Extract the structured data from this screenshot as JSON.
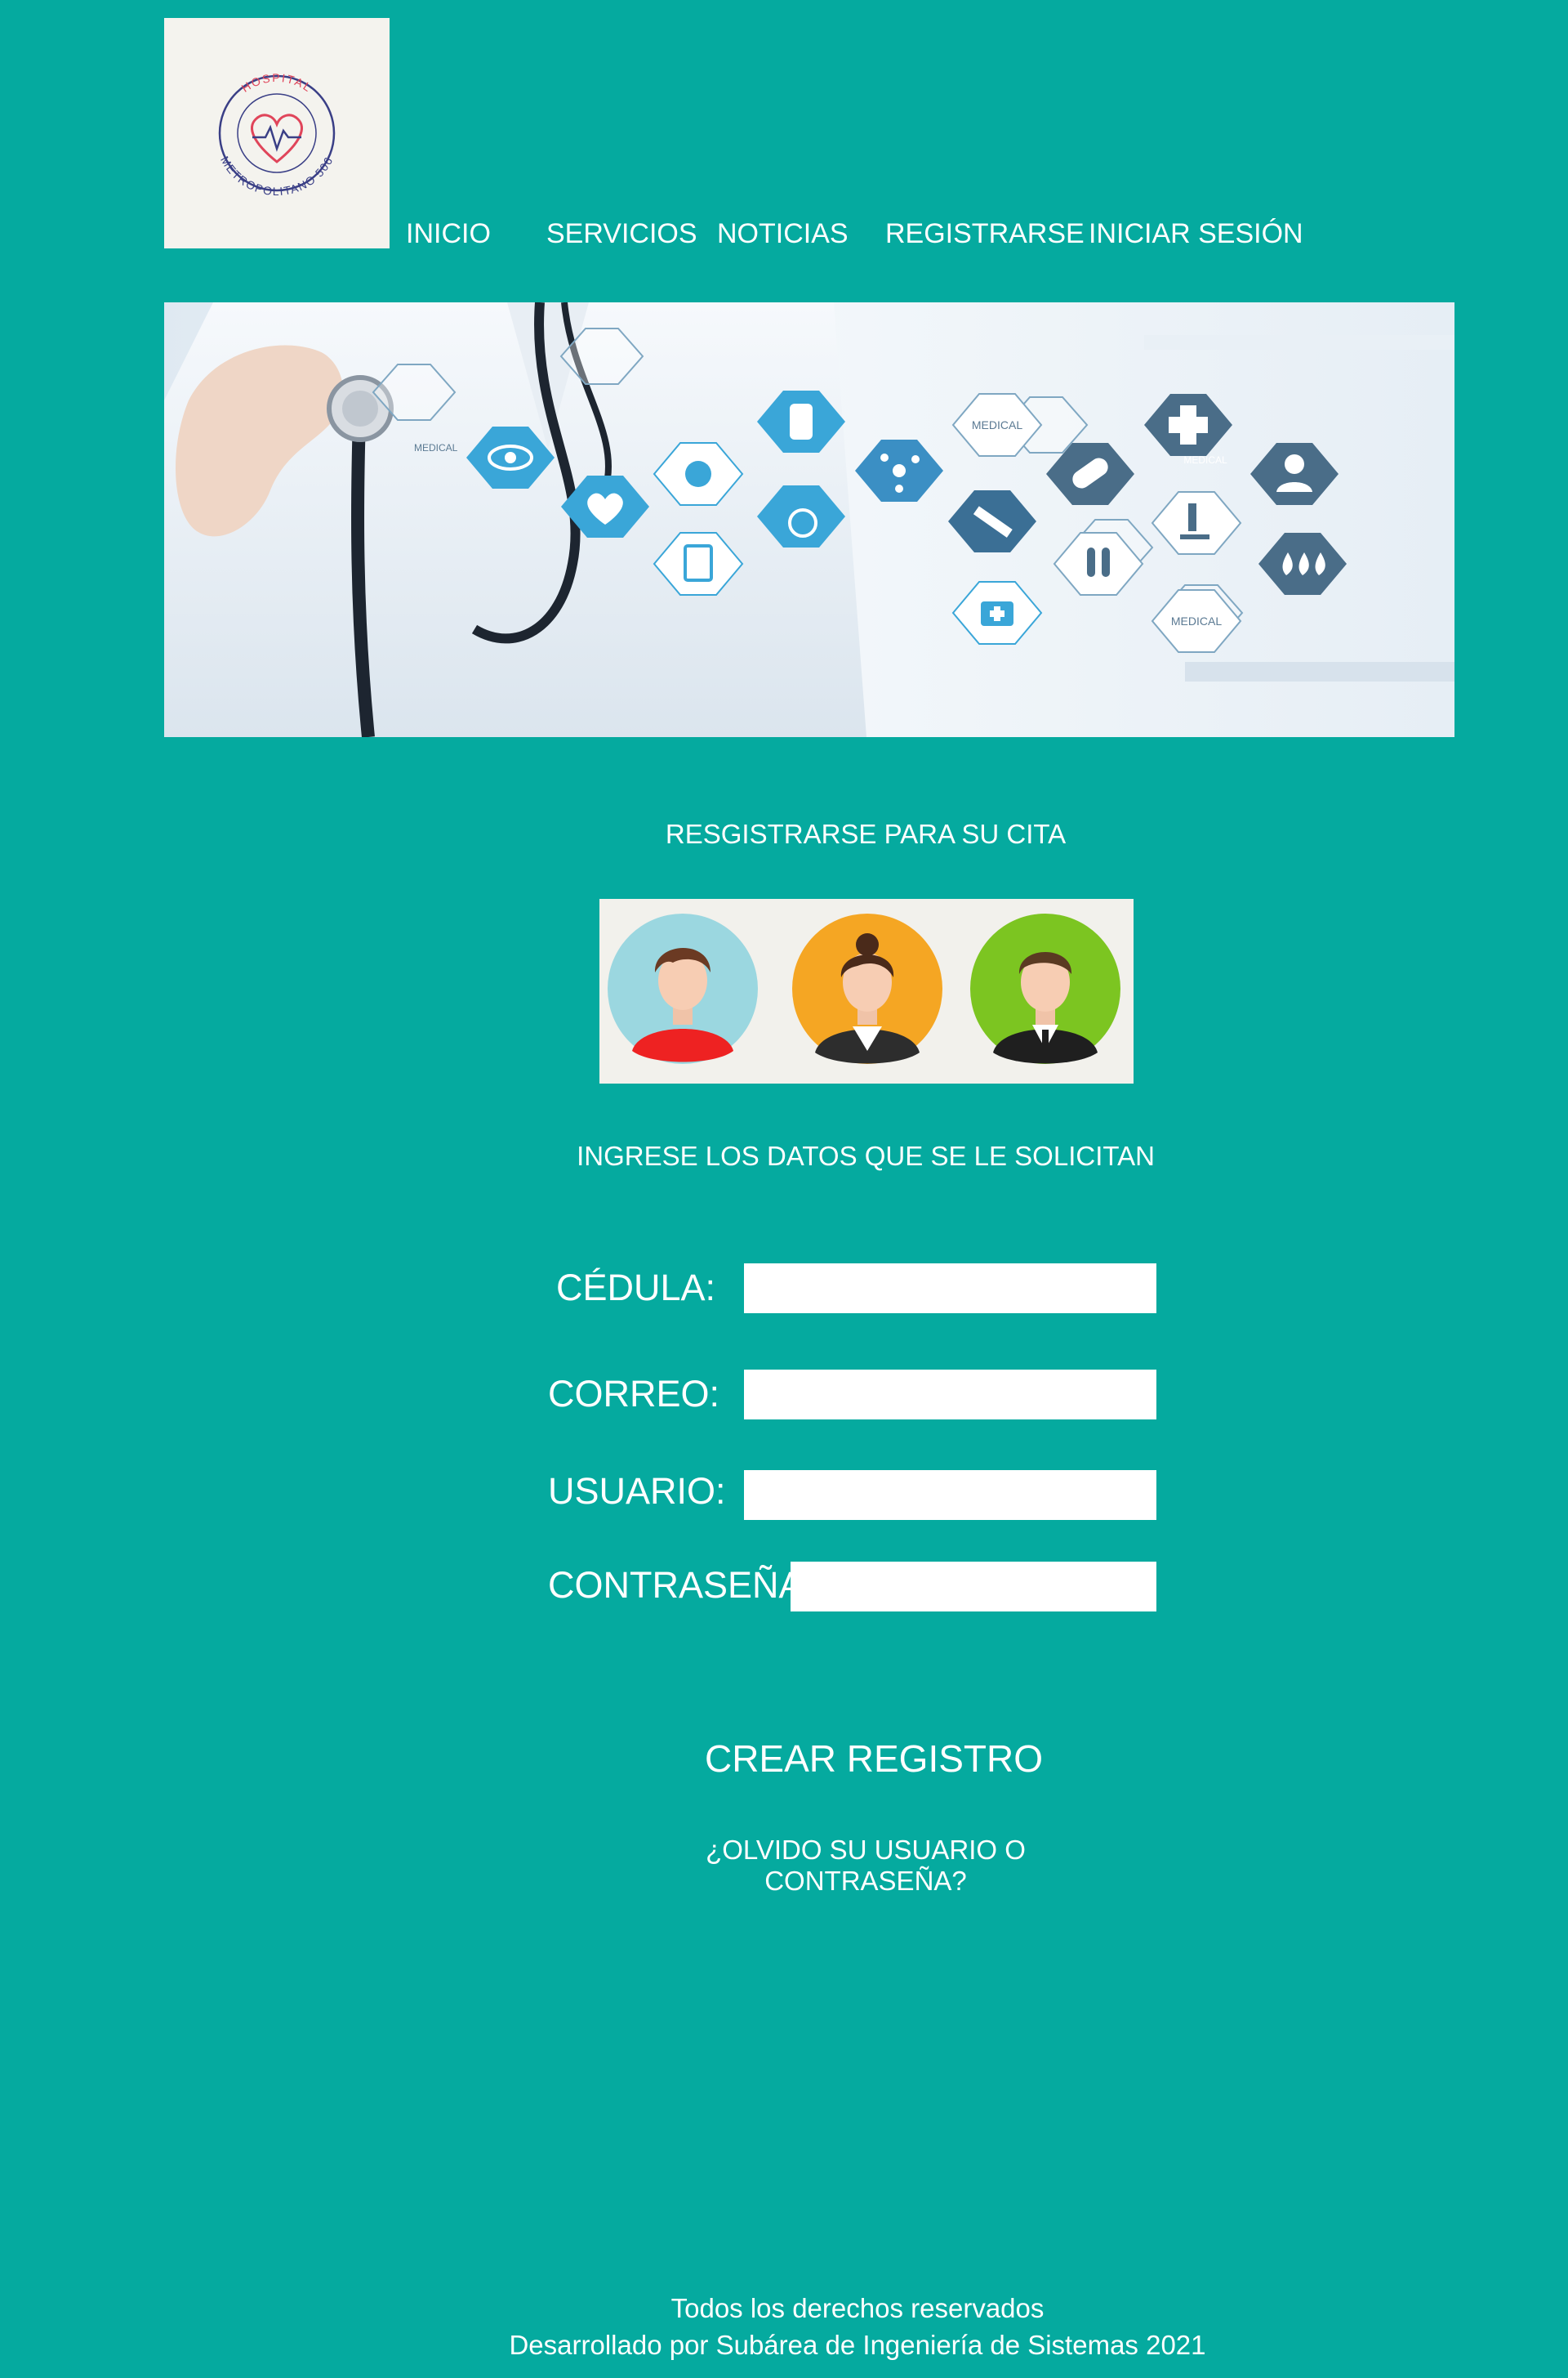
{
  "logo": {
    "text_top": "HOSPITAL",
    "text_bottom": "METROPOLITANO 506",
    "accent_red": "#e0455a",
    "accent_navy": "#3a3f86"
  },
  "nav": {
    "items": [
      {
        "label": "INICIO"
      },
      {
        "label": "SERVICIOS"
      },
      {
        "label": "NOTICIAS"
      },
      {
        "label": "REGISTRARSE"
      },
      {
        "label": "INICIAR SESIÓN"
      }
    ]
  },
  "banner": {
    "labels": [
      "MEDICAL",
      "MEDICAL",
      "MEDICAL",
      "MEDICAL"
    ]
  },
  "register": {
    "heading": "RESGISTRARSE PARA SU CITA",
    "instructions": "INGRESE LOS DATOS QUE SE LE SOLICITAN"
  },
  "avatars": [
    {
      "icon": "young-man-avatar-icon",
      "bg": "#9bd7e0"
    },
    {
      "icon": "businesswoman-avatar-icon",
      "bg": "#f5a623"
    },
    {
      "icon": "businessman-avatar-icon",
      "bg": "#7cc521"
    }
  ],
  "form": {
    "cedula_label": "CÉDULA:",
    "correo_label": "CORREO:",
    "usuario_label": "USUARIO:",
    "contrasena_label": "CONTRASEÑA:",
    "cedula_value": "",
    "correo_value": "",
    "usuario_value": "",
    "contrasena_value": "",
    "submit_label": "CREAR REGISTRO",
    "forgot_label": "¿OLVIDO SU USUARIO O CONTRASEÑA?"
  },
  "footer": {
    "line1": "Todos los derechos reservados",
    "line2": "Desarrollado por Subárea de Ingeniería de Sistemas 2021"
  },
  "colors": {
    "background": "#05aa9f",
    "panel": "#f4f3ee",
    "text": "#ffffff"
  }
}
